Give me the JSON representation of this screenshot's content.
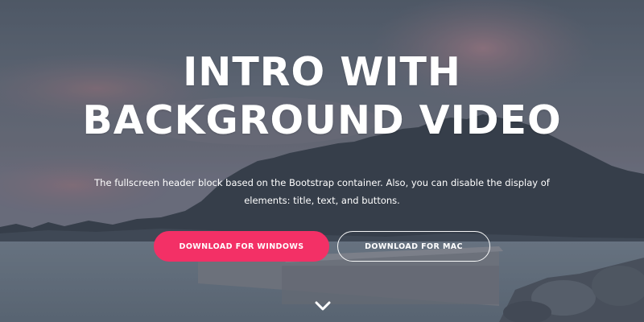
{
  "hero": {
    "title_line1": "INTRO WITH",
    "title_line2": "BACKGROUND VIDEO",
    "subtitle_line1": "The fullscreen header block based on the Bootstrap container. Also, you can disable the display of",
    "subtitle_line2": "elements: title, text, and buttons.",
    "primary_button": "DOWNLOAD FOR WINDOWS",
    "secondary_button": "DOWNLOAD FOR MAC",
    "scroll_icon": "chevron-down-icon"
  },
  "colors": {
    "accent": "#f33066",
    "text": "#ffffff",
    "sky": "#6f7a86",
    "water": "#7c8a99"
  }
}
